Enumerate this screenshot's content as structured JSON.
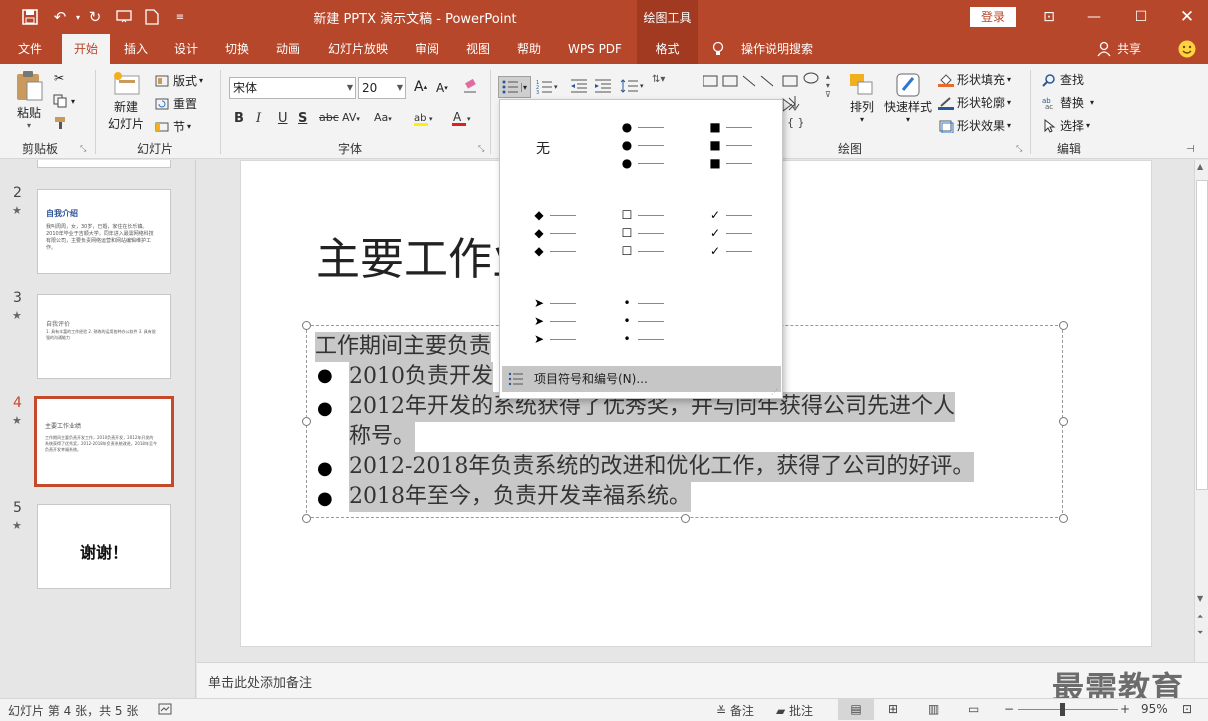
{
  "titlebar": {
    "doc_title": "新建 PPTX 演示文稿  -  PowerPoint",
    "context_tab_group": "绘图工具",
    "login": "登录"
  },
  "tabs": [
    {
      "label": "文件"
    },
    {
      "label": "开始"
    },
    {
      "label": "插入"
    },
    {
      "label": "设计"
    },
    {
      "label": "切换"
    },
    {
      "label": "动画"
    },
    {
      "label": "幻灯片放映"
    },
    {
      "label": "审阅"
    },
    {
      "label": "视图"
    },
    {
      "label": "帮助"
    },
    {
      "label": "WPS PDF"
    },
    {
      "label": "格式"
    }
  ],
  "tell_me": "操作说明搜索",
  "share": "共享",
  "ribbon": {
    "clipboard": {
      "paste": "粘贴",
      "label": "剪贴板"
    },
    "slides": {
      "new_slide_line1": "新建",
      "new_slide_line2": "幻灯片",
      "layout": "版式",
      "reset": "重置",
      "section": "节",
      "label": "幻灯片"
    },
    "font": {
      "name": "宋体",
      "size": "20",
      "label": "字体"
    },
    "drawing": {
      "arrange": "排列",
      "quick_styles": "快速样式",
      "fill": "形状填充",
      "outline": "形状轮廓",
      "effects": "形状效果",
      "label": "绘图"
    },
    "editing": {
      "find": "查找",
      "replace": "替换",
      "select": "选择",
      "label": "编辑"
    }
  },
  "bullet_menu": {
    "none_label": "无",
    "options": [
      {
        "symbol": "●"
      },
      {
        "symbol": "■"
      },
      {
        "symbol": "◆"
      },
      {
        "symbol": "☐"
      },
      {
        "symbol": "✓"
      },
      {
        "symbol": "➤"
      },
      {
        "symbol": "•"
      }
    ],
    "footer": "项目符号和编号(N)..."
  },
  "thumbnails": [
    {
      "num": "2",
      "title": "自我介绍",
      "body": "我叫周周，女，30岁，已婚，家住在长乐镇。2010年毕业于吉顺大学，同年进入最需网络科技有限公司，主要负责网络运营和网站编辑维护工作。"
    },
    {
      "num": "3",
      "title": "自我评价",
      "body": "1. 具有丰富的工作经验 2. 熟练的运用各种办公软件 3. 具有很强的沟通能力"
    },
    {
      "num": "4",
      "title": "主要工作业绩",
      "body": "工作期间主要负责开发工作，2010负责开发，2012年开发的系统获得了优秀奖，2012-2018年负责系统改进，2018年至今负责开发幸福系统。"
    },
    {
      "num": "5",
      "title": "谢谢！",
      "body": ""
    }
  ],
  "slide": {
    "title": "主要工作业绩",
    "intro": "工作期间主要负责",
    "bullets": [
      "2010负责开发",
      "2012年开发的系统获得了优秀奖，并与同年获得公司先进个人",
      "称号。",
      "2012-2018年负责系统的改进和优化工作，获得了公司的好评。",
      "2018年至今，负责开发幸福系统。"
    ]
  },
  "notes_placeholder": "单击此处添加备注",
  "watermark": "最需教育",
  "status": {
    "slide_info": "幻灯片 第 4 张，共 5 张",
    "notes": "备注",
    "comments": "批注",
    "zoom": "95%"
  },
  "colors": {
    "accent": "#b7472a",
    "selection_border": "#c5492b"
  }
}
